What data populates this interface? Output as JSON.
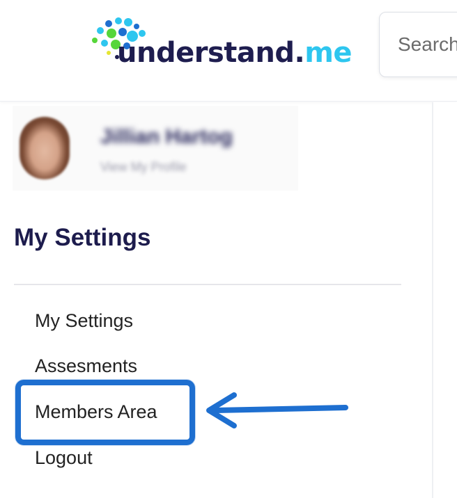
{
  "header": {
    "logo": {
      "word": "understand",
      "dot": ".",
      "tld": "me",
      "colors": {
        "navy": "#1e1d4f",
        "cyan": "#2ec6ef",
        "green": "#56d63a",
        "blue": "#1e6fd0"
      }
    },
    "search": {
      "placeholder": "Search"
    }
  },
  "profile": {
    "name": "Jillian Hartog",
    "link": "View My Profile"
  },
  "settings": {
    "title": "My Settings",
    "menu": [
      {
        "label": "My Settings"
      },
      {
        "label": "Assesments"
      },
      {
        "label": "Members Area",
        "highlighted": true
      },
      {
        "label": "Logout"
      }
    ]
  },
  "annotation": {
    "highlight_color": "#1e6fd0",
    "arrow": "left-arrow-icon"
  }
}
